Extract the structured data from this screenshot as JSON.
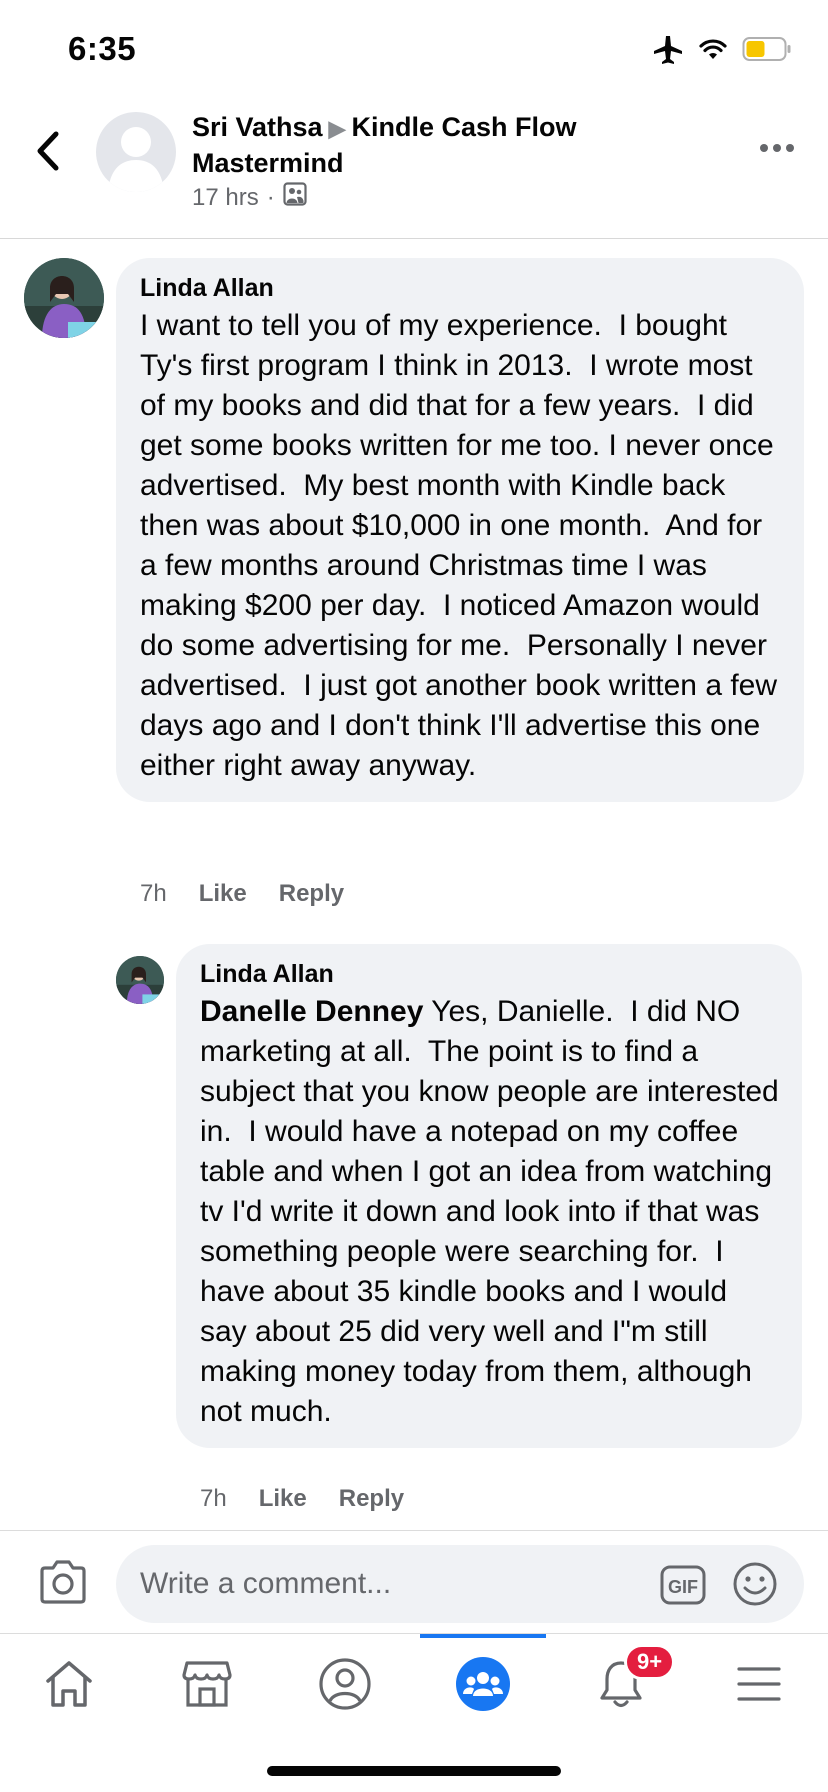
{
  "status_bar": {
    "time": "6:35",
    "battery_color": "#f7c600"
  },
  "post": {
    "author": "Sri Vathsa",
    "group": "Kindle Cash Flow Mastermind",
    "time": "17 hrs",
    "separator": "·",
    "audience_icon": "group-audience-icon"
  },
  "comments": [
    {
      "author": "Linda Allan",
      "text": "I want to tell you of my experience.  I bought Ty's first program I think in 2013.  I wrote most of my books and did that for a few years.  I did get some books written for me too. I never once advertised.  My best month with Kindle back then was about $10,000 in one month.  And for a few months around Christmas time I was making $200 per day.  I noticed Amazon would do some advertising for me.  Personally I never advertised.  I just got another book written a few days ago and I don't think I'll advertise this one either right away anyway.",
      "time": "7h",
      "like": "Like",
      "reply": "Reply"
    },
    {
      "author": "Linda Allan",
      "mention": "Danelle Denney",
      "text": " Yes, Danielle.  I did NO marketing at all.  The point is to find a subject that you know people are interested in.  I would have a notepad on my coffee table and when I got an idea from watching tv I'd write it down and look into if that was something people were searching for.  I have about 35 kindle books and I would say about 25 did very well and I\"m still making money today from them, although not much.",
      "time": "7h",
      "like": "Like",
      "reply": "Reply"
    }
  ],
  "composer": {
    "placeholder": "Write a comment...",
    "gif_label": "GIF"
  },
  "nav": {
    "items": [
      "home-icon",
      "marketplace-icon",
      "profile-icon",
      "groups-icon",
      "notifications-icon",
      "menu-icon"
    ],
    "active": "groups-icon",
    "notifications_badge": "9+",
    "accent": "#1877f2"
  }
}
